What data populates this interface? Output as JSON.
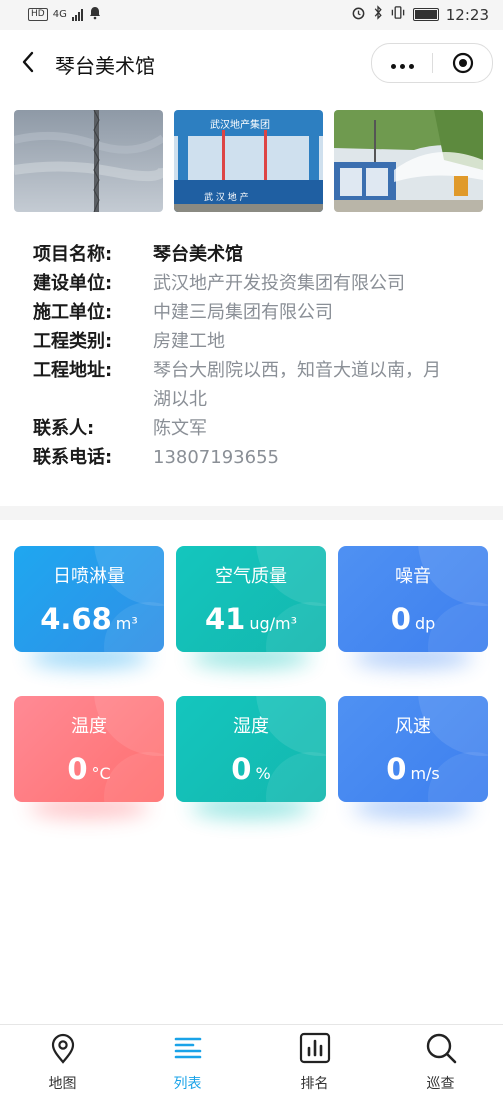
{
  "status_bar": {
    "left_badges": [
      "HD",
      "4G"
    ],
    "time": "12:23",
    "icons": [
      "alarm-icon",
      "bluetooth-icon",
      "vibrate-icon",
      "battery-icon"
    ]
  },
  "header": {
    "title": "琴台美术馆",
    "back_icon": "chevron-left-icon",
    "more_icon": "more-dots-icon",
    "close_icon": "target-icon"
  },
  "photos": [
    {
      "name": "site-photo-tower-crane"
    },
    {
      "name": "site-photo-gate"
    },
    {
      "name": "site-photo-spray"
    }
  ],
  "project": {
    "fields": [
      {
        "label": "项目名称:",
        "value": "琴台美术馆",
        "strong": true
      },
      {
        "label": "建设单位:",
        "value": "武汉地产开发投资集团有限公司"
      },
      {
        "label": "施工单位:",
        "value": "中建三局集团有限公司"
      },
      {
        "label": "工程类别:",
        "value": "房建工地"
      },
      {
        "label": "工程地址:",
        "value": "琴台大剧院以西，知音大道以南，月",
        "value2": "湖以北"
      },
      {
        "label": "联系人:",
        "value": "陈文军"
      },
      {
        "label": "联系电话:",
        "value": "13807193655"
      }
    ]
  },
  "gate_text": {
    "sign": "武汉地产集团",
    "wall": "武 汉 地 产"
  },
  "sensors": [
    {
      "title": "日喷淋量",
      "value": "4.68",
      "unit": "m³",
      "color_from": "#1fa7f0",
      "color_to": "#2f8fe6"
    },
    {
      "title": "空气质量",
      "value": "41",
      "unit": "ug/m³",
      "color_from": "#14c6be",
      "color_to": "#13b7ae"
    },
    {
      "title": "噪音",
      "value": "0",
      "unit": "dp",
      "color_from": "#4f91f3",
      "color_to": "#3d7fee"
    },
    {
      "title": "温度",
      "value": "0",
      "unit": "°C",
      "color_from": "#ff8a95",
      "color_to": "#ff6f6f"
    },
    {
      "title": "湿度",
      "value": "0",
      "unit": "%",
      "color_from": "#14c6be",
      "color_to": "#13b7ae"
    },
    {
      "title": "风速",
      "value": "0",
      "unit": "m/s",
      "color_from": "#4f91f3",
      "color_to": "#3d7fee"
    }
  ],
  "tabs": [
    {
      "label": "地图",
      "icon": "map-pin-icon",
      "active": false
    },
    {
      "label": "列表",
      "icon": "list-icon",
      "active": true
    },
    {
      "label": "排名",
      "icon": "bar-chart-icon",
      "active": false
    },
    {
      "label": "巡查",
      "icon": "search-icon",
      "active": false
    }
  ],
  "colors": {
    "accent": "#1aa3e8",
    "label": "#1a1a1a",
    "value": "#8a8f96"
  }
}
